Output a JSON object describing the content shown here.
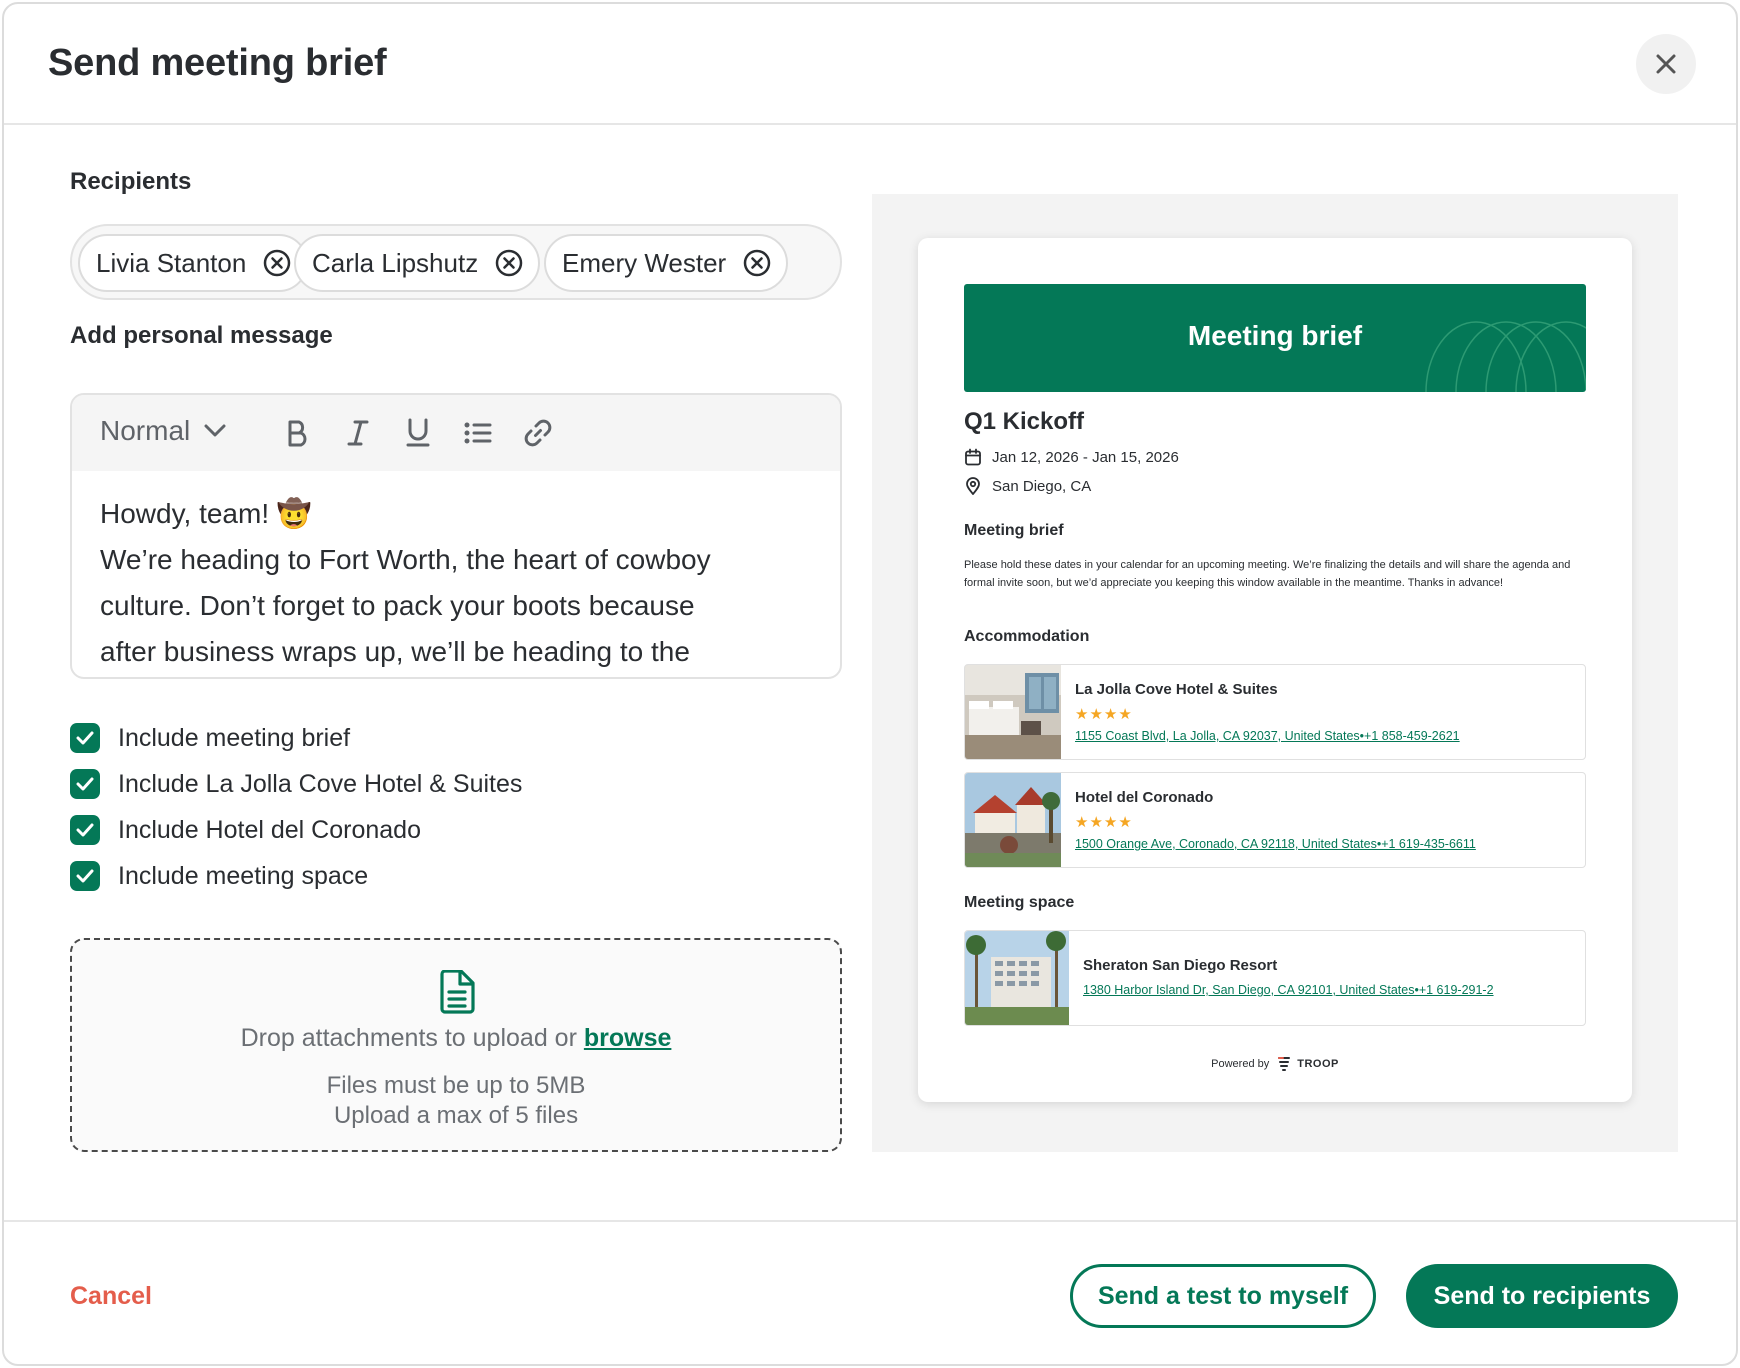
{
  "dialog": {
    "title": "Send meeting brief"
  },
  "recipients": {
    "label": "Recipients",
    "chips": [
      {
        "name": "Livia Stanton"
      },
      {
        "name": "Carla Lipshutz"
      },
      {
        "name": "Emery Wester"
      }
    ]
  },
  "message": {
    "label": "Add personal message",
    "format": "Normal",
    "lines": [
      "Howdy, team! 🤠",
      "We’re heading to Fort Worth, the heart of cowboy",
      "culture. Don’t forget to pack your boots because",
      "after business wraps up, we’ll be heading to the"
    ]
  },
  "options": [
    {
      "label": "Include meeting brief",
      "checked": true
    },
    {
      "label": "Include La Jolla Cove Hotel & Suites",
      "checked": true
    },
    {
      "label": "Include Hotel del Coronado",
      "checked": true
    },
    {
      "label": "Include meeting space",
      "checked": true
    }
  ],
  "upload": {
    "prompt": "Drop attachments to upload or",
    "browse": "browse",
    "limit_size": "Files must be up to 5MB",
    "limit_count": "Upload a max of 5 files"
  },
  "preview": {
    "banner_title": "Meeting brief",
    "meeting_name": "Q1 Kickoff",
    "dates": "Jan 12, 2026 - Jan 15, 2026",
    "location": "San Diego, CA",
    "brief_heading": "Meeting brief",
    "brief_text": "Please hold these dates in your calendar for an upcoming meeting. We’re finalizing the details and will share the agenda and formal invite soon, but we’d appreciate you keeping this window available in the meantime. Thanks in advance!",
    "accommodation_heading": "Accommodation",
    "hotels": [
      {
        "name": "La Jolla Cove Hotel & Suites",
        "stars": "★★★★",
        "address": "1155 Coast Blvd, La Jolla, CA 92037, United States•+1 858-459-2621"
      },
      {
        "name": "Hotel del Coronado",
        "stars": "★★★★",
        "address": "1500 Orange Ave, Coronado, CA 92118, United States•+1 619-435-6611"
      }
    ],
    "space_heading": "Meeting space",
    "space": {
      "name": "Sheraton San Diego Resort",
      "address": "1380 Harbor Island Dr, San Diego, CA 92101, United States•+1 619-291-2"
    },
    "powered_by": "Powered by",
    "brand": "TROOP"
  },
  "footer": {
    "cancel": "Cancel",
    "test": "Send a test to myself",
    "send": "Send to recipients"
  },
  "colors": {
    "brand_green": "#047857",
    "cancel_red": "#e45d4b",
    "star": "#f5a623"
  }
}
